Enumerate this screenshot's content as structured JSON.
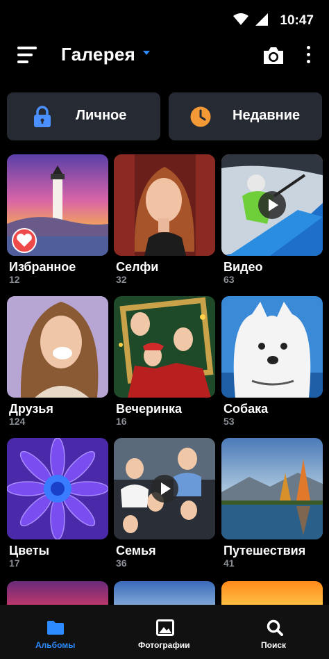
{
  "status_bar": {
    "time": "10:47"
  },
  "app_bar": {
    "title": "Галерея"
  },
  "quick_actions": [
    {
      "label": "Личное",
      "icon": "lock-icon",
      "color": "#4a90ff"
    },
    {
      "label": "Недавние",
      "icon": "clock-icon",
      "color": "#f39a36"
    }
  ],
  "albums": [
    {
      "name": "Избранное",
      "count": "12",
      "badge": "heart-icon"
    },
    {
      "name": "Селфи",
      "count": "32"
    },
    {
      "name": "Видео",
      "count": "63",
      "badge": "play-icon"
    },
    {
      "name": "Друзья",
      "count": "124"
    },
    {
      "name": "Вечеринка",
      "count": "16"
    },
    {
      "name": "Собака",
      "count": "53"
    },
    {
      "name": "Цветы",
      "count": "17"
    },
    {
      "name": "Семья",
      "count": "36",
      "badge": "play-icon"
    },
    {
      "name": "Путешествия",
      "count": "41"
    }
  ],
  "bottom_nav": [
    {
      "label": "Альбомы",
      "icon": "folder-icon",
      "active": true
    },
    {
      "label": "Фотографии",
      "icon": "image-icon",
      "active": false
    },
    {
      "label": "Поиск",
      "icon": "search-icon",
      "active": false
    }
  ],
  "colors": {
    "accent": "#2d8bff",
    "card": "#262b33",
    "muted_text": "#8b8f96"
  }
}
